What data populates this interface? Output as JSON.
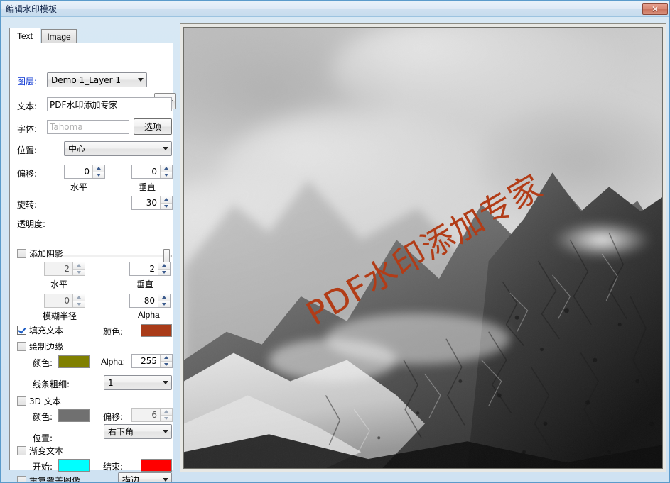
{
  "window": {
    "title": "编辑水印模板",
    "close_label": "✕"
  },
  "tabs": [
    {
      "label": "Text",
      "active": true
    },
    {
      "label": "Image",
      "active": false
    }
  ],
  "form": {
    "layer": {
      "label": "图层:",
      "value": "Demo 1_Layer 1",
      "settings_icon": "gear-icon"
    },
    "text": {
      "label": "文本:",
      "value": "PDF水印添加专家"
    },
    "font": {
      "label": "字体:",
      "value": "Tahoma",
      "options_button": "选项"
    },
    "position": {
      "label": "位置:",
      "value": "中心"
    },
    "offset": {
      "label": "偏移:",
      "horizontal_value": "0",
      "horizontal_label": "水平",
      "vertical_value": "0",
      "vertical_label": "垂直"
    },
    "rotation": {
      "label": "旋转:",
      "value": "30"
    },
    "transparency": {
      "label": "透明度:",
      "slider_percent": 100
    },
    "shadow": {
      "label": "添加阴影",
      "checked": false,
      "horizontal_value": "2",
      "horizontal_label": "水平",
      "vertical_value": "2",
      "vertical_label": "垂直",
      "blur_value": "0",
      "blur_label": "模糊半径",
      "alpha_value": "80",
      "alpha_label": "Alpha"
    },
    "fill_text": {
      "label": "填充文本",
      "checked": true,
      "color_label": "颜色:",
      "color": "#a93b18"
    },
    "draw_border": {
      "label": "绘制边缘",
      "checked": false,
      "color_label": "颜色:",
      "color": "#808000",
      "alpha_label": "Alpha:",
      "alpha_value": "255",
      "thickness_label": "线条粗细:",
      "thickness_value": "1"
    },
    "text_3d": {
      "label": "3D 文本",
      "checked": false,
      "color_label": "颜色:",
      "color": "#707070",
      "offset_label": "偏移:",
      "offset_value": "6",
      "position_label": "位置:",
      "position_value": "右下角"
    },
    "gradient_text": {
      "label": "渐变文本",
      "checked": false,
      "start_label": "开始:",
      "start_color": "#00ffff",
      "end_label": "结束:",
      "end_color": "#ff0000"
    },
    "tile": {
      "label": "重复覆盖图像",
      "checked": false,
      "mode_value": "描边"
    }
  },
  "preview": {
    "watermark_text": "PDF水印添加专家",
    "watermark_color": "#b23c17",
    "watermark_rotation_deg": 30,
    "image_description": "grayscale mountain peak with clouds"
  }
}
